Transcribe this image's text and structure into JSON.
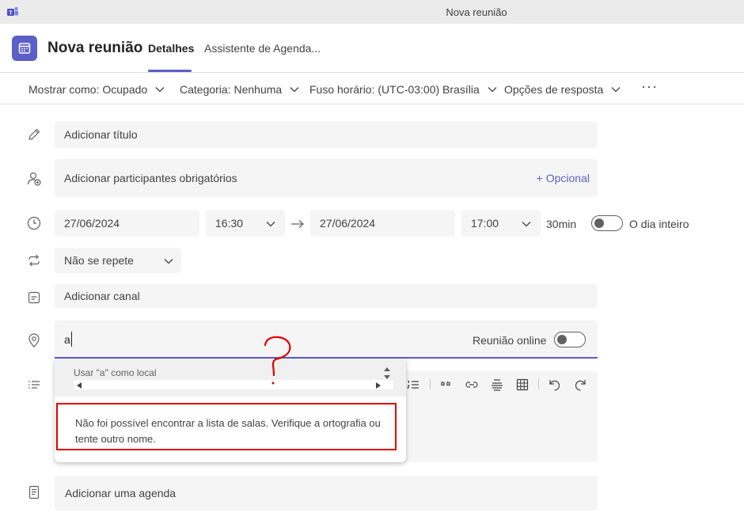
{
  "window": {
    "title": "Nova reunião"
  },
  "header": {
    "title": "Nova reunião",
    "tabs": [
      {
        "label": "Detalhes",
        "active": true
      },
      {
        "label": "Assistente de Agenda..."
      }
    ]
  },
  "options": {
    "show_as": "Mostrar como: Ocupado",
    "category": "Categoria: Nenhuma",
    "timezone": "Fuso horário: (UTC-03:00) Brasília",
    "response": "Opções de resposta",
    "more": "···"
  },
  "form": {
    "title_placeholder": "Adicionar título",
    "attendees_placeholder": "Adicionar participantes obrigatórios",
    "optional_label": "+ Opcional",
    "start_date": "27/06/2024",
    "start_time": "16:30",
    "end_date": "27/06/2024",
    "end_time": "17:00",
    "duration": "30min",
    "all_day_label": "O dia inteiro",
    "all_day_on": false,
    "repeat": "Não se repete",
    "channel_placeholder": "Adicionar canal",
    "location_value": "a",
    "online_meeting_label": "Reunião online",
    "online_meeting_on": false,
    "agenda_placeholder": "Adicionar uma agenda"
  },
  "location_dropdown": {
    "use_as_location": "Usar \"a\" como local",
    "error_message": "Não foi possível encontrar a lista de salas. Verifique a ortografia ou tente outro nome."
  },
  "colors": {
    "accent": "#5b5fc7",
    "highlight": "#e00000"
  }
}
